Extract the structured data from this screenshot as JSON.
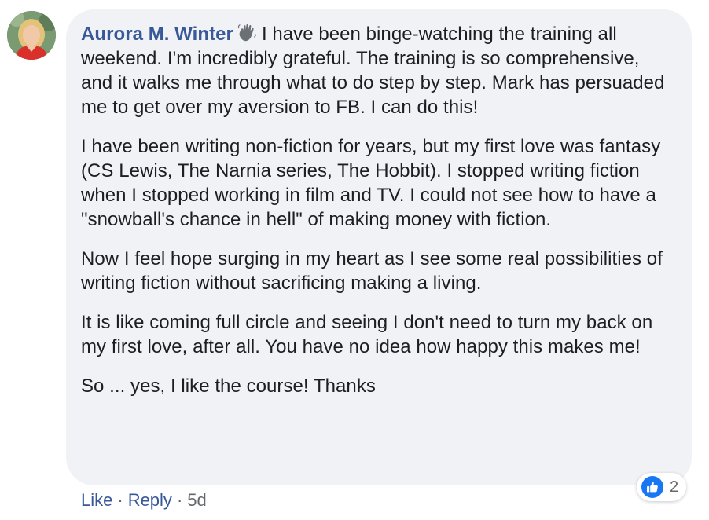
{
  "comment": {
    "author": "Aurora M. Winter",
    "author_badge_icon": "wave-hand-icon",
    "first_line": "I have been binge-watching the training all weekend. I'm incredibly grateful. The training is so comprehensive, and it walks me through what to do step by step. Mark has persuaded me to get over my aversion to FB. I can do this!",
    "paragraphs": [
      "I have been writing non-fiction for years, but my first love was fantasy (CS Lewis, The Narnia series, The Hobbit). I stopped writing fiction when I stopped working in film and TV. I could not see how to have a \"snowball's chance in hell\" of making money with fiction.",
      "Now I feel hope surging in my heart as I see some real possibilities of writing fiction without sacrificing making a living.",
      "It is like coming full circle and seeing I don't need to turn my back on my first love, after all. You have no idea how happy this makes me!",
      "So ... yes, I like the course! Thanks"
    ]
  },
  "actions": {
    "like_label": "Like",
    "reply_label": "Reply",
    "separator": "·",
    "timestamp": "5d"
  },
  "reactions": {
    "icon": "thumbs-up-icon",
    "count": "2"
  },
  "colors": {
    "author": "#385898",
    "bubble": "#f0f2f5",
    "meta": "#65676b",
    "like_badge": "#1877f2"
  }
}
